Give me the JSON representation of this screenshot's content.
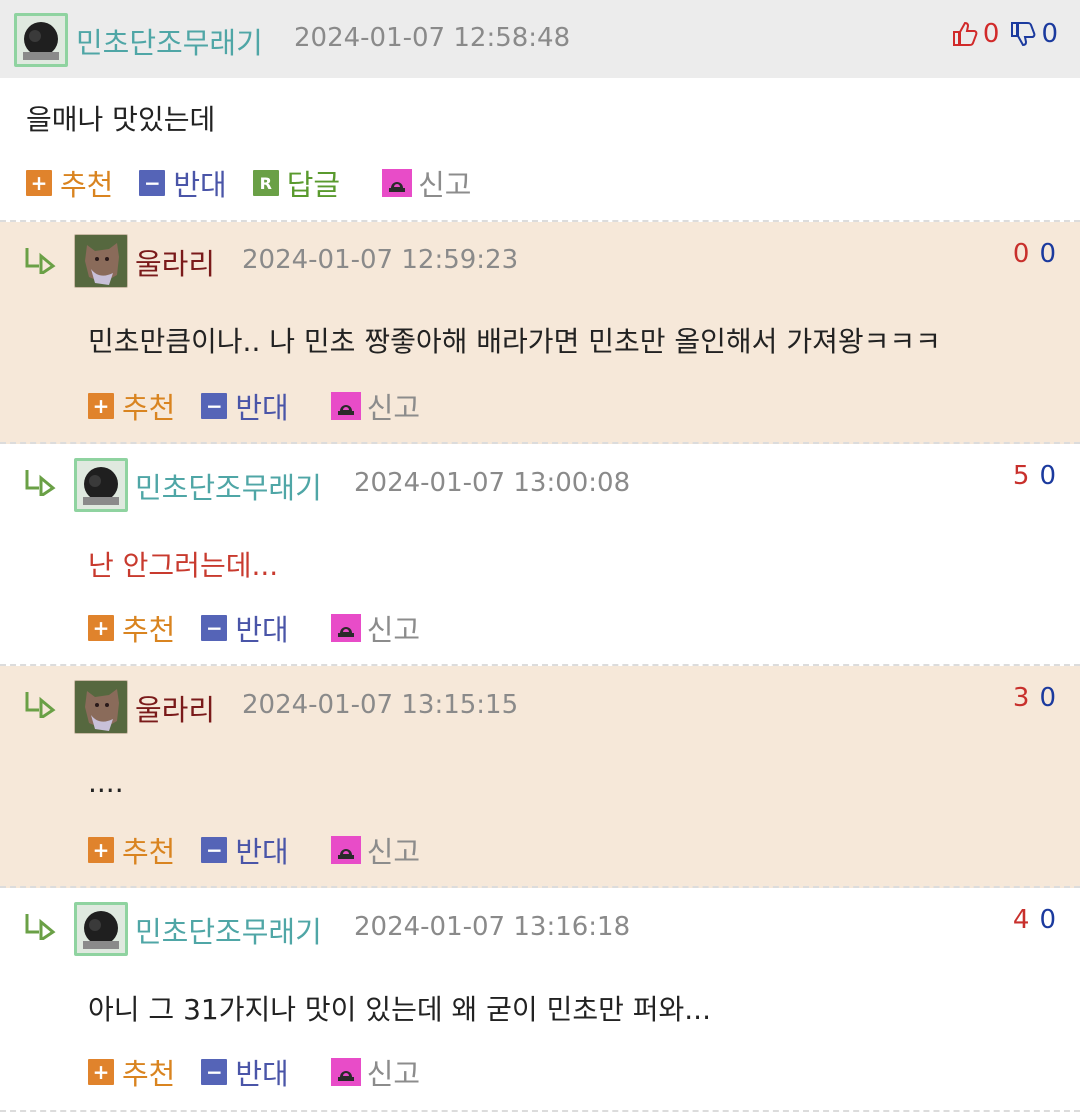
{
  "comments": [
    {
      "nick": "민초단조무래기",
      "time": "2024-01-07 12:58:48",
      "up": "0",
      "down": "0",
      "text": "을매나 맛있는데",
      "actions": {
        "recommend": "추천",
        "oppose": "반대",
        "reply": "답글",
        "reply_icon": "R",
        "report": "신고"
      }
    },
    {
      "nick": "울라리",
      "time": "2024-01-07 12:59:23",
      "up": "0",
      "down": "0",
      "text": "민초만큼이나.. 나 민초 짱좋아해 배라가면 민초만 올인해서 가져왕ㅋㅋㅋ",
      "actions": {
        "recommend": "추천",
        "oppose": "반대",
        "report": "신고"
      }
    },
    {
      "nick": "민초단조무래기",
      "time": "2024-01-07 13:00:08",
      "up": "5",
      "down": "0",
      "text": "난 안그러는데...",
      "actions": {
        "recommend": "추천",
        "oppose": "반대",
        "report": "신고"
      }
    },
    {
      "nick": "울라리",
      "time": "2024-01-07 13:15:15",
      "up": "3",
      "down": "0",
      "text": "....",
      "actions": {
        "recommend": "추천",
        "oppose": "반대",
        "report": "신고"
      }
    },
    {
      "nick": "민초단조무래기",
      "time": "2024-01-07 13:16:18",
      "up": "4",
      "down": "0",
      "text": "아니 그 31가지나 맛이 있는데 왜 굳이 민초만 퍼와...",
      "actions": {
        "recommend": "추천",
        "oppose": "반대",
        "report": "신고"
      }
    }
  ],
  "colors": {
    "nick_teal": "#4fa6a6",
    "nick_maroon": "#7a1a1a",
    "reply_bg": "#f6e8d9",
    "header_bg": "#ececec",
    "up_red": "#d12a2a",
    "down_blue": "#1b3a9e"
  },
  "icons": {
    "thumbs_up": "thumbs-up-icon",
    "thumbs_down": "thumbs-down-icon",
    "reply_arrow": "reply-arrow-icon",
    "plus": "plus-icon",
    "minus": "minus-icon",
    "siren": "siren-icon"
  }
}
